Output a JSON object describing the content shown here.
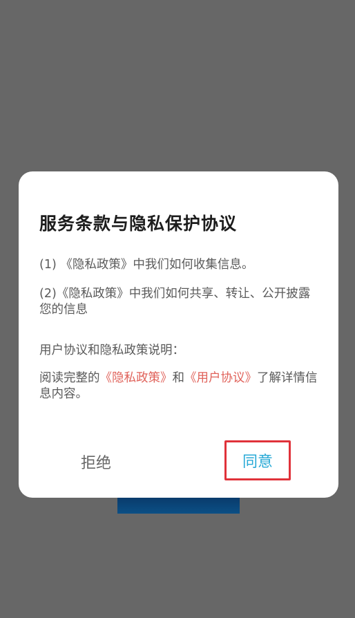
{
  "dialog": {
    "title": "服务条款与隐私保护协议",
    "items": [
      {
        "prefix": "(1) ",
        "link": "《隐私政策》",
        "suffix": "中我们如何收集信息。"
      },
      {
        "prefix": "(2)",
        "link": "《隐私政策》",
        "suffix": "中我们如何共享、转让、公开披露您的信息"
      }
    ],
    "section_heading": "用户协议和隐私政策说明：",
    "read_full": {
      "prefix": "阅读完整的",
      "privacy_link": "《隐私政策》",
      "and": "和",
      "user_link": "《用户协议》",
      "suffix": "了解详情信息内容。"
    },
    "reject_label": "拒绝",
    "agree_label": "同意"
  },
  "colors": {
    "overlay": "#676767",
    "link": "#e0625a",
    "agree": "#27a9d6",
    "highlight_border": "#e0323a"
  }
}
